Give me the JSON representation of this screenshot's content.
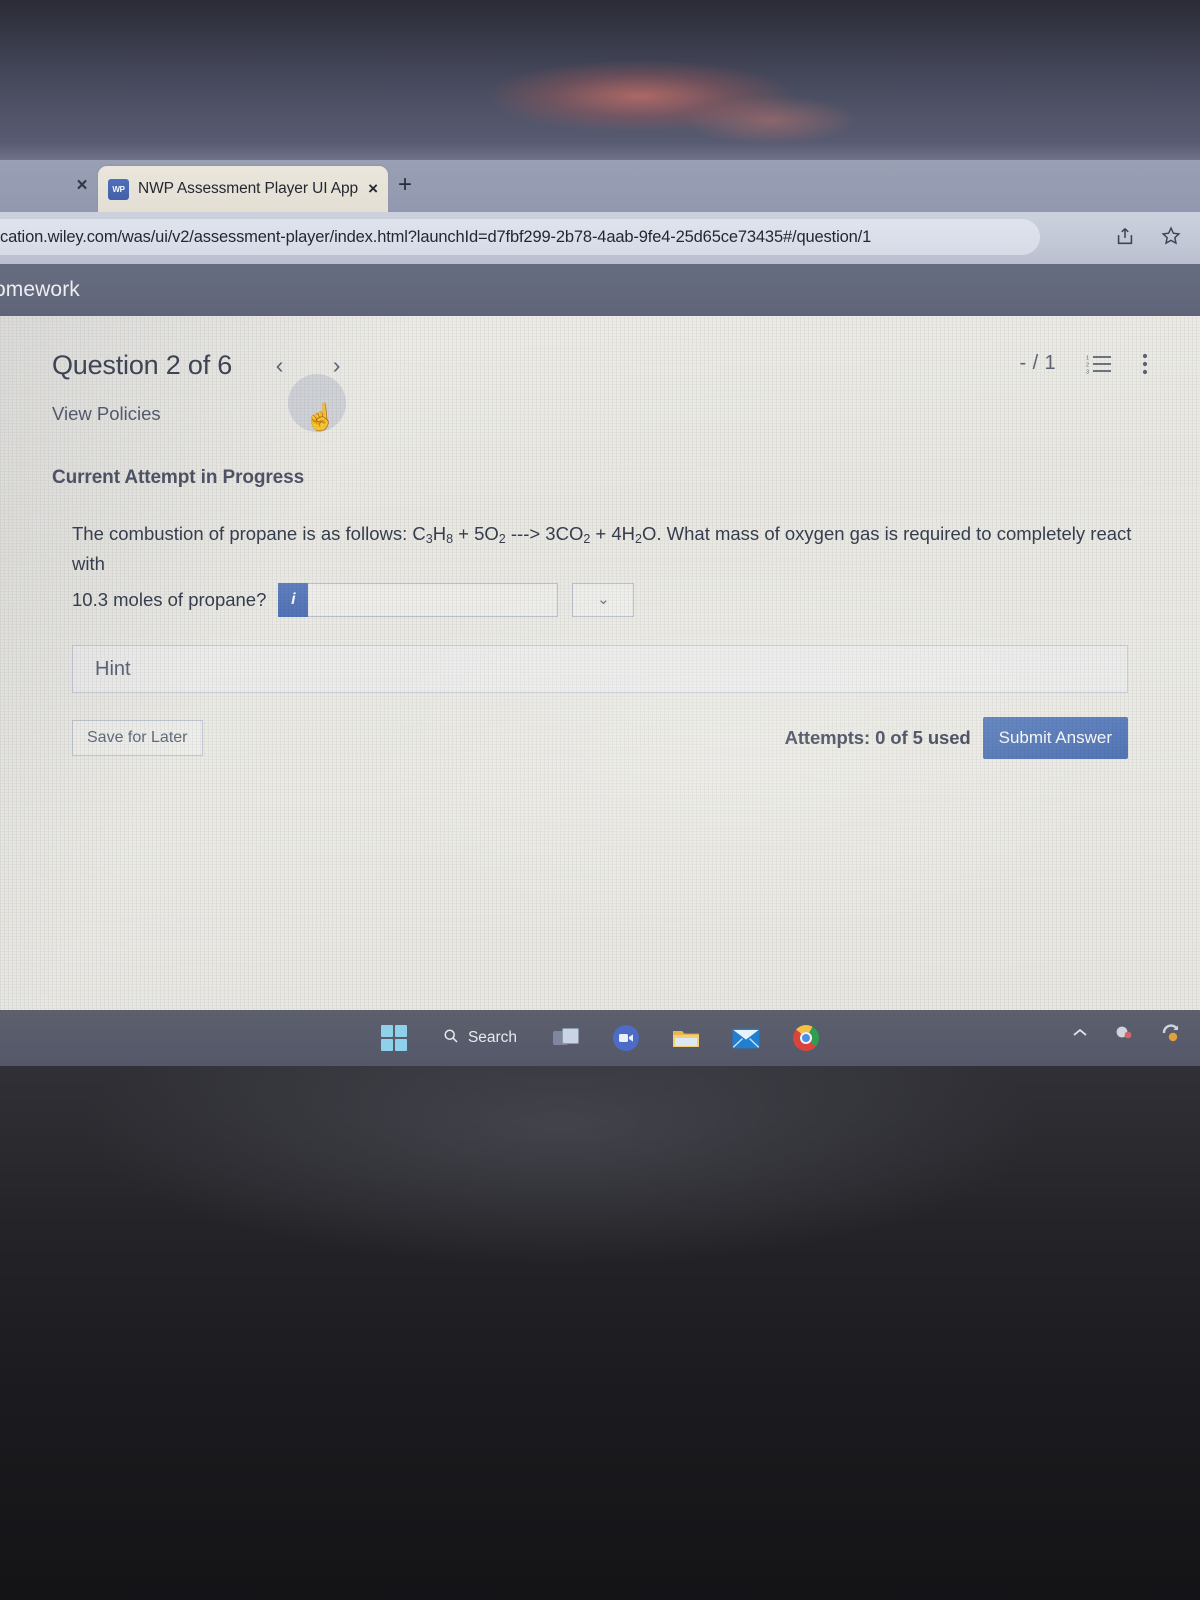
{
  "browser": {
    "tab": {
      "favicon_label": "WP",
      "title": "NWP Assessment Player UI Appli",
      "close_label": "×"
    },
    "ghost_tab_close": "×",
    "new_tab_label": "+",
    "url": "cation.wiley.com/was/ui/v2/assessment-player/index.html?launchId=d7fbf299-2b78-4aab-9fe4-25d65ce73435#/question/1",
    "share_icon": "share-icon",
    "bookmark_icon": "star-icon"
  },
  "app_header": {
    "title": "omework"
  },
  "question": {
    "heading": "Question 2 of 6",
    "prev_label": "‹",
    "next_label": "›",
    "score": "- / 1",
    "list_icon": "numbered-list-icon",
    "menu_icon": "kebab-menu-icon",
    "view_policies": "View Policies",
    "attempt_status": "Current Attempt in Progress",
    "text_part1": "The combustion of propane is as follows: C",
    "eq": {
      "s1": "3",
      "p1": "H",
      "s2": "8",
      "p2": " + 5O",
      "s3": "2",
      "arrow": " ---> 3CO",
      "s4": "2",
      "p3": " + 4H",
      "s5": "2",
      "p4": "O."
    },
    "text_part2": " What mass of oxygen gas is required to completely react with",
    "text_part3": "10.3 moles of propane?",
    "info_button_label": "i",
    "answer_value": "",
    "answer_placeholder": "",
    "unit_value": "",
    "unit_chevron": "⌄",
    "hint_label": "Hint"
  },
  "actions": {
    "save_label": "Save for Later",
    "attempts_label": "Attempts: 0 of 5 used",
    "submit_label": "Submit Answer"
  },
  "taskbar": {
    "start_icon": "windows-start-icon",
    "search_label": "Search",
    "search_icon": "search-icon",
    "taskview_icon": "task-view-icon",
    "teams_icon": "teams-camera-icon",
    "explorer_icon": "file-explorer-icon",
    "mail_icon": "mail-icon",
    "chrome_icon": "chrome-icon",
    "tray_chevron": "^",
    "tray_icons": [
      "notification-icon",
      "sync-icon"
    ]
  },
  "colors": {
    "accent_blue": "#4f75bc",
    "taskbar": "#55586a",
    "app_header": "#5d6379",
    "page_bg": "#efede7"
  }
}
